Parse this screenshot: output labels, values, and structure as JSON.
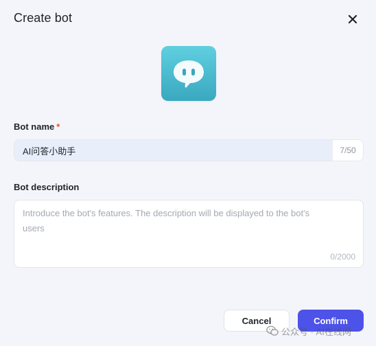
{
  "dialog": {
    "title": "Create bot",
    "close_icon": "close-icon"
  },
  "avatar": {
    "icon": "chat-bubble-face-icon",
    "color_top": "#5fcfe0",
    "color_bottom": "#3aa8bf"
  },
  "bot_name": {
    "label": "Bot name",
    "required_mark": "*",
    "value": "AI问答小助手",
    "counter": "7/50"
  },
  "bot_description": {
    "label": "Bot description",
    "placeholder": "Introduce the bot's features. The description will be displayed to the bot's users",
    "value": "",
    "counter": "0/2000"
  },
  "actions": {
    "cancel_label": "Cancel",
    "confirm_label": "Confirm",
    "confirm_color": "#4d53e8"
  },
  "watermark": {
    "text": "公众号 · AI在线网"
  }
}
